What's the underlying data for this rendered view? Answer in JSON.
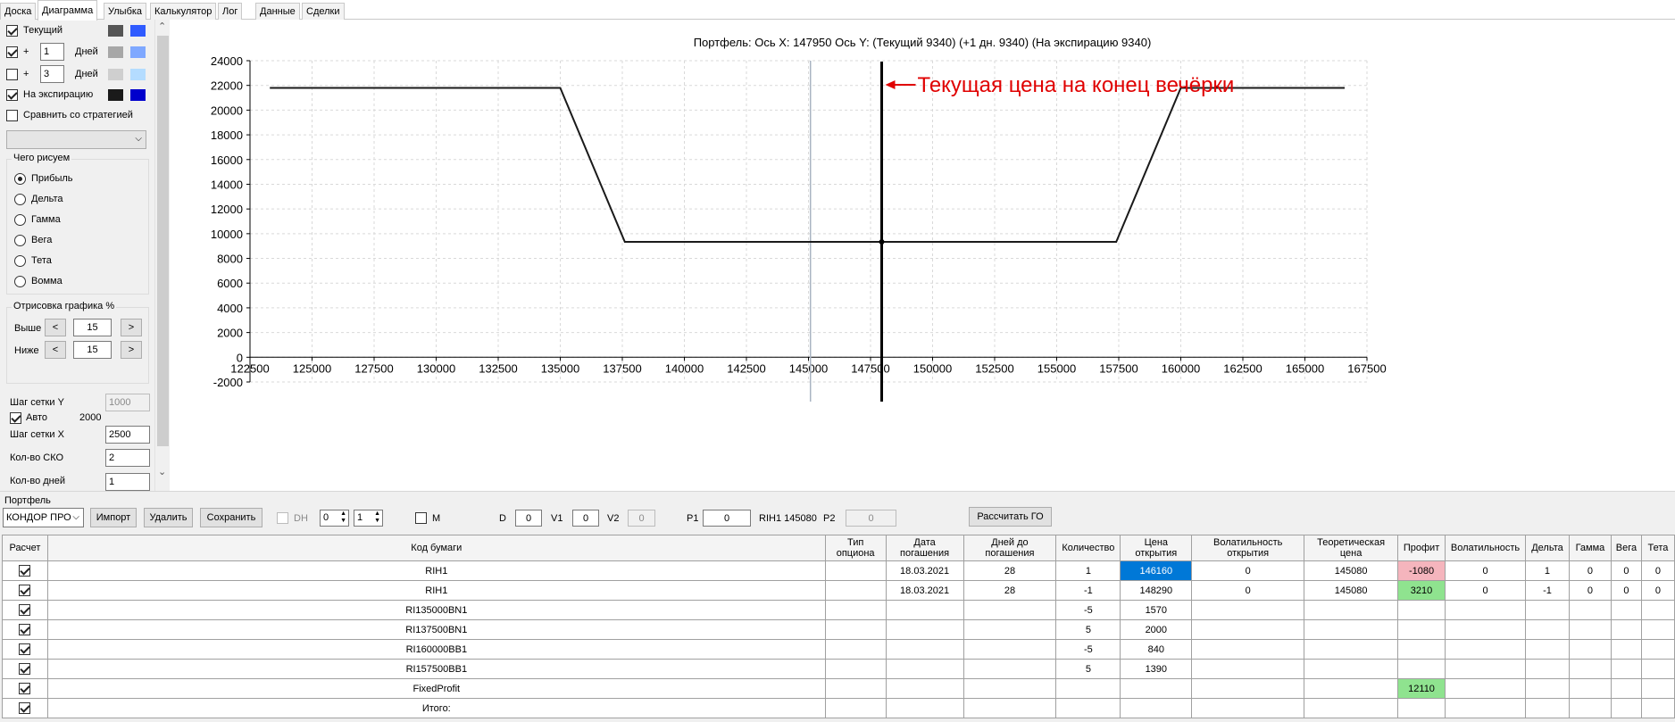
{
  "tabs": [
    "Доска",
    "Диаграмма",
    "Улыбка",
    "Калькулятор",
    "Лог",
    "Данные",
    "Сделки"
  ],
  "active_tab": "Диаграмма",
  "left": {
    "current_label": "Текущий",
    "plus1_sign": "+",
    "plus1_days": "1",
    "plus1_unit": "Дней",
    "plus3_sign": "+",
    "plus3_days": "3",
    "plus3_unit": "Дней",
    "expiry_label": "На экспирацию",
    "compare_label": "Сравнить со стратегией",
    "what_title": "Чего рисуем",
    "radios": [
      "Прибыль",
      "Дельта",
      "Гамма",
      "Вега",
      "Тета",
      "Вомма"
    ],
    "draw_title": "Отрисовка графика %",
    "above_label": "Выше",
    "above_value": "15",
    "below_label": "Ниже",
    "below_value": "15",
    "btn_left": "<",
    "btn_right": ">",
    "grid_y_label": "Шаг сетки Y",
    "grid_y_value": "1000",
    "auto_label": "Авто",
    "auto_value": "2000",
    "grid_x_label": "Шаг сетки X",
    "grid_x_value": "2500",
    "sko_label": "Кол-во СКО",
    "sko_value": "2",
    "days_label": "Кол-во дней",
    "days_value": "1",
    "colors": {
      "current": [
        "#555555",
        "#2f5bff"
      ],
      "plus1": [
        "#a7a7a7",
        "#7fa8ff"
      ],
      "plus3": [
        "#cfcfcf",
        "#b4dcff"
      ],
      "expiry": [
        "#1a1a1a",
        "#0000cc"
      ]
    }
  },
  "chart_title": "Портфель: Ось X: 147950 Ось Y:  (Текущий 9340)  (+1 дн. 9340)  (На экспирацию 9340)",
  "chart_data": {
    "type": "line",
    "x_ticks": [
      122500,
      125000,
      127500,
      130000,
      132500,
      135000,
      137500,
      140000,
      142500,
      145000,
      147500,
      150000,
      152500,
      155000,
      157500,
      160000,
      162500,
      165000,
      167500
    ],
    "y_ticks": [
      -2000,
      0,
      2000,
      4000,
      6000,
      8000,
      10000,
      12000,
      14000,
      16000,
      18000,
      20000,
      22000,
      24000
    ],
    "xlim": [
      122500,
      167500
    ],
    "ylim": [
      -2000,
      24000
    ],
    "grid": true,
    "series": [
      {
        "x": [
          123300,
          135000,
          137600,
          157400,
          160000,
          166600
        ],
        "y": [
          21800,
          21800,
          9340,
          9340,
          21800,
          21800
        ]
      }
    ],
    "current_price_x": 147950,
    "gray_line_x": 145080,
    "annotation": "Текущая цена на конец вечёрки",
    "colors": {
      "series": "#1a1a1a",
      "grid": "#d9d9d9",
      "annotation": "#e00000",
      "gray_line": "#a9b4c2"
    }
  },
  "portfolio": {
    "label": "Портфель",
    "strategy_value": "КОНДОР ПРО",
    "import_btn": "Импорт",
    "delete_btn": "Удалить",
    "save_btn": "Сохранить",
    "dh_label": "DH",
    "spin1": "0",
    "spin2": "1",
    "m_label": "M",
    "d_label": "D",
    "d_value": "0",
    "v1_label": "V1",
    "v1_value": "0",
    "v2_label": "V2",
    "v2_value": "0",
    "p1_label": "P1",
    "p1_value": "0",
    "rih_text": "RIH1 145080",
    "p2_label": "P2",
    "p2_value": "0",
    "go_btn": "Рассчитать ГО"
  },
  "table": {
    "headers": [
      "Расчет",
      "Код бумаги",
      "Тип опциона",
      "Дата погашения",
      "Дней до погашения",
      "Количество",
      "Цена открытия",
      "Волатильность открытия",
      "Теоретическая цена",
      "Профит",
      "Волатильность",
      "Дельта",
      "Гамма",
      "Вега",
      "Тета"
    ],
    "rows": [
      [
        "",
        "RIH1",
        "",
        "18.03.2021",
        "28",
        "1",
        "146160",
        "0",
        "145080",
        "-1080",
        "0",
        "1",
        "0",
        "0",
        "0"
      ],
      [
        "",
        "RIH1",
        "",
        "18.03.2021",
        "28",
        "-1",
        "148290",
        "0",
        "145080",
        "3210",
        "0",
        "-1",
        "0",
        "0",
        "0"
      ],
      [
        "",
        "RI135000BN1",
        "",
        "",
        "",
        "-5",
        "1570",
        "",
        "",
        "",
        "",
        "",
        "",
        "",
        ""
      ],
      [
        "",
        "RI137500BN1",
        "",
        "",
        "",
        "5",
        "2000",
        "",
        "",
        "",
        "",
        "",
        "",
        "",
        ""
      ],
      [
        "",
        "RI160000BB1",
        "",
        "",
        "",
        "-5",
        "840",
        "",
        "",
        "",
        "",
        "",
        "",
        "",
        ""
      ],
      [
        "",
        "RI157500BB1",
        "",
        "",
        "",
        "5",
        "1390",
        "",
        "",
        "",
        "",
        "",
        "",
        "",
        ""
      ],
      [
        "",
        "FixedProfit",
        "",
        "",
        "",
        "",
        "",
        "",
        "",
        "12110",
        "",
        "",
        "",
        "",
        ""
      ],
      [
        "",
        "Итого:",
        "",
        "",
        "",
        "",
        "",
        "",
        "",
        "",
        "",
        "",
        "",
        "",
        ""
      ]
    ]
  }
}
